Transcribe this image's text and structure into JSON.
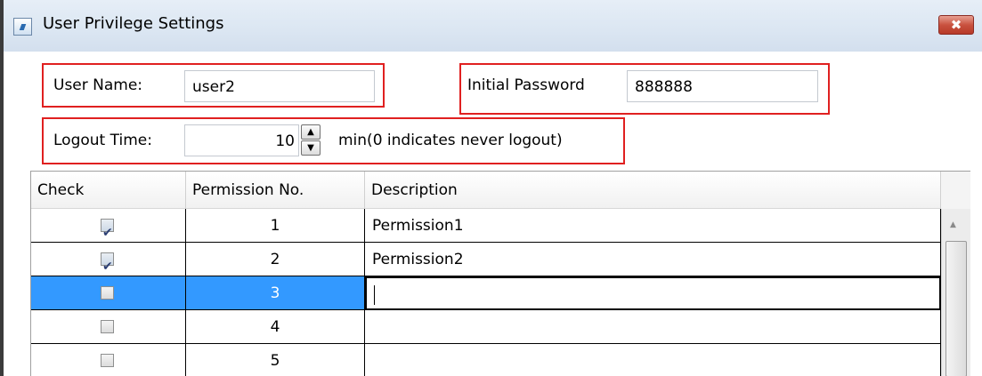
{
  "window": {
    "title": "User Privilege Settings",
    "close_glyph": "✖",
    "app_icon": "settings-window-icon"
  },
  "form": {
    "user_name_label": "User Name:",
    "user_name_value": "user2",
    "password_label": "Initial Password",
    "password_value": "888888",
    "logout_label": "Logout Time:",
    "logout_value": "10",
    "logout_hint": "min(0 indicates never logout)",
    "spin_up": "▲",
    "spin_down": "▼"
  },
  "table": {
    "columns": [
      "Check",
      "Permission No.",
      "Description"
    ],
    "rows": [
      {
        "checked": true,
        "no": "1",
        "description": "Permission1"
      },
      {
        "checked": true,
        "no": "2",
        "description": "Permission2"
      },
      {
        "checked": false,
        "no": "3",
        "description": "",
        "selected": true
      },
      {
        "checked": false,
        "no": "4",
        "description": ""
      },
      {
        "checked": false,
        "no": "5",
        "description": ""
      }
    ]
  },
  "colors": {
    "highlight_box": "#e02020",
    "selection": "#3399ff"
  }
}
